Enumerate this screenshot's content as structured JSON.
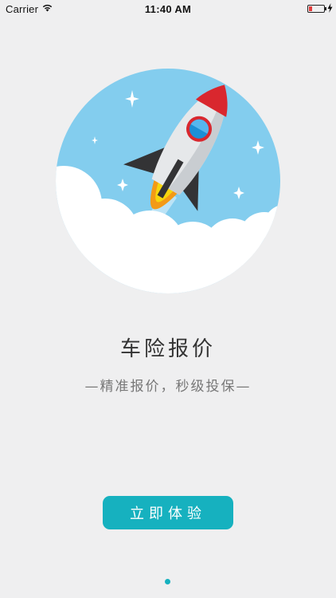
{
  "status_bar": {
    "carrier": "Carrier",
    "time": "11:40 AM",
    "battery_level": 0.2,
    "icons": [
      "wifi-icon",
      "battery-icon",
      "charging-bolt-icon"
    ]
  },
  "hero": {
    "icon": "rocket-illustration",
    "sky_color": "#83cdee",
    "rocket_nose_color": "#d9272e",
    "flame_color": "#f6c80d"
  },
  "title": "车险报价",
  "subtitle": "—精准报价，秒级投保—",
  "cta": {
    "label": "立即体验",
    "color": "#16b1bf"
  },
  "pager": {
    "current_page": 1,
    "active_color": "#16b1bf"
  }
}
